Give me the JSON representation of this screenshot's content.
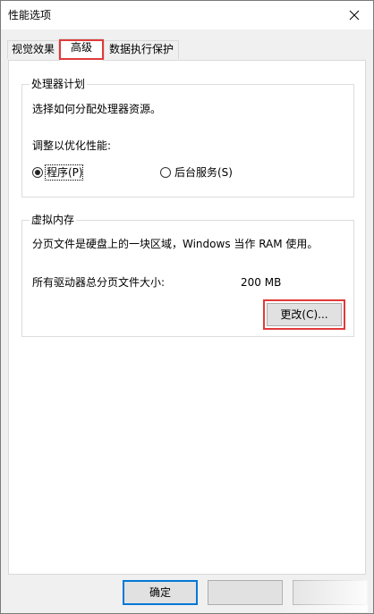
{
  "window": {
    "title": "性能选项"
  },
  "tabs": [
    {
      "label": "视觉效果",
      "active": false
    },
    {
      "label": "高级",
      "active": true
    },
    {
      "label": "数据执行保护",
      "active": false
    }
  ],
  "processor": {
    "title": "处理器计划",
    "description": "选择如何分配处理器资源。",
    "adjust_label": "调整以优化性能:",
    "options": [
      {
        "label": "程序(P)",
        "selected": true
      },
      {
        "label": "后台服务(S)",
        "selected": false
      }
    ]
  },
  "virtual_memory": {
    "title": "虚拟内存",
    "description": "分页文件是硬盘上的一块区域，Windows 当作 RAM 使用。",
    "total_label": "所有驱动器总分页文件大小:",
    "total_value": "200 MB",
    "change_button": "更改(C)..."
  },
  "footer": {
    "ok_button": "确定",
    "cancel_button": "",
    "apply_button": ""
  },
  "colors": {
    "highlight": "#e03a3a",
    "focus_blue": "#0078d7"
  }
}
